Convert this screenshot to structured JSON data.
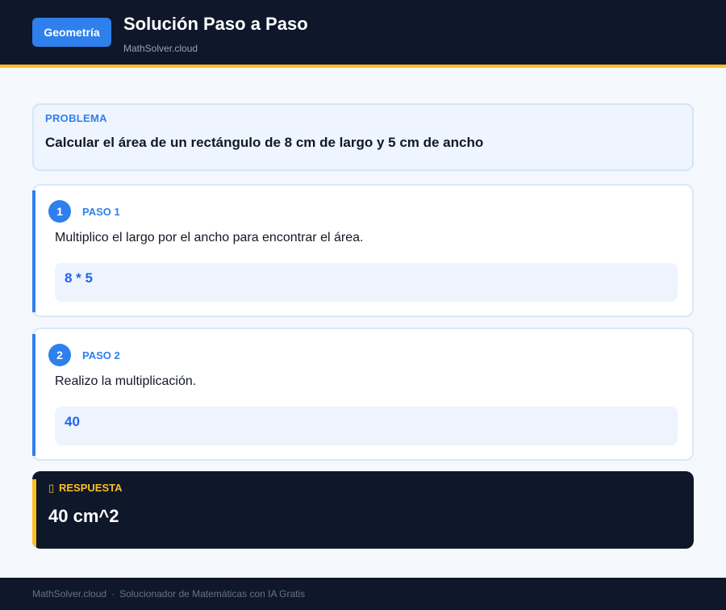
{
  "header": {
    "badge": "Geometría",
    "title": "Solución Paso a Paso",
    "subtitle": "MathSolver.cloud"
  },
  "problem": {
    "label": "PROBLEMA",
    "text": "Calcular el área de un rectángulo de 8 cm de largo y 5 cm de ancho"
  },
  "steps": [
    {
      "number": "1",
      "label": "PASO 1",
      "description": "Multiplico el largo por el ancho para encontrar el área.",
      "expression": "8 * 5"
    },
    {
      "number": "2",
      "label": "PASO 2",
      "description": "Realizo la multiplicación.",
      "expression": "40"
    }
  ],
  "answer": {
    "icon": "check-icon",
    "label": "RESPUESTA",
    "value": "40 cm^2"
  },
  "footer": {
    "site": "MathSolver.cloud",
    "separator": "·",
    "tagline": "Solucionador de Matemáticas con IA Gratis"
  },
  "colors": {
    "accent": "#2f80ed",
    "dark": "#0f172a",
    "highlight": "#fbbf24"
  }
}
